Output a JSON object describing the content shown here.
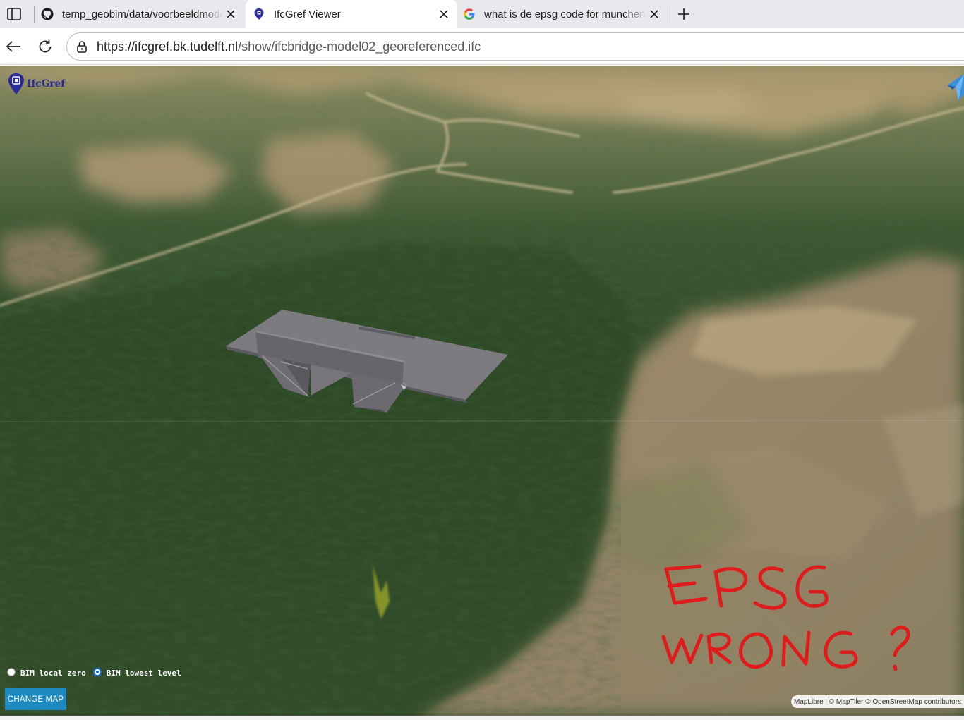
{
  "browser": {
    "tabs": [
      {
        "title": "temp_geobim/data/voorbeeldmodellen",
        "favicon": "github-icon",
        "active": false
      },
      {
        "title": "IfcGref Viewer",
        "favicon": "ifcgref-pin-icon",
        "active": true
      },
      {
        "title": "what is de epsg code for munchen",
        "favicon": "google-icon",
        "active": false
      }
    ],
    "url": {
      "host": "https://ifcgref.bk.tudelft.nl",
      "path": "/show/ifcbridge-model02_georeferenced.ifc"
    }
  },
  "viewer": {
    "logo_text": "IfcGref",
    "radio_options": [
      {
        "label": "BIM local zero",
        "checked": false
      },
      {
        "label": "BIM lowest level",
        "checked": true
      }
    ],
    "change_map_label": "CHANGE MAP",
    "attribution": "MapLibre | © MapTiler © OpenStreetMap contributors",
    "annotation_lines": [
      "EPSG",
      "WRONG ?"
    ],
    "colors": {
      "annotation": "#e01b1b",
      "button": "#1f8ac0",
      "forest": "#35502c",
      "bridge": "#7d7a80"
    }
  }
}
